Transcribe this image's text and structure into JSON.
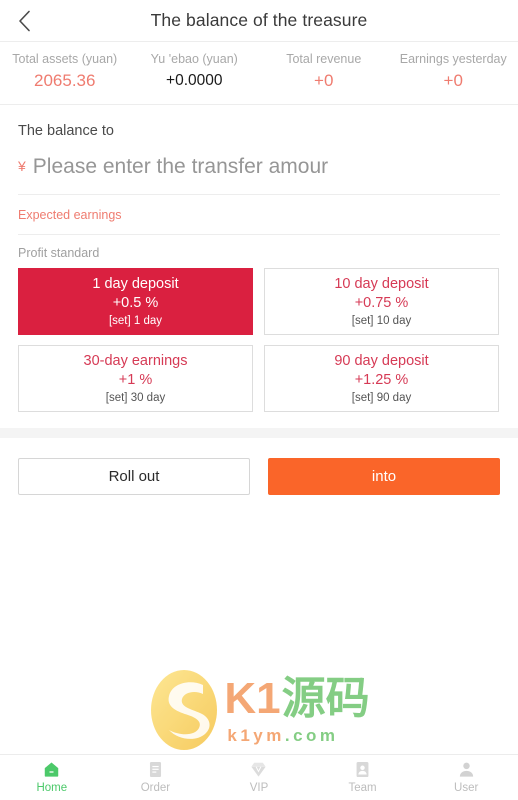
{
  "header": {
    "title": "The balance of the treasure",
    "back_icon": "chevron-left-icon"
  },
  "stats": [
    {
      "label": "Total assets (yuan)",
      "value": "2065.36",
      "tone": "red"
    },
    {
      "label": "Yu 'ebao (yuan)",
      "value": "+0.0000",
      "tone": "dark"
    },
    {
      "label": "Total revenue",
      "value": "+0",
      "tone": "red"
    },
    {
      "label": "Earnings yesterday",
      "value": "+0",
      "tone": "red"
    }
  ],
  "transfer": {
    "section_label": "The balance to",
    "currency_symbol": "¥",
    "amount_value": "",
    "amount_placeholder": "Please enter the transfer amour",
    "expected_earnings_label": "Expected earnings",
    "profit_standard_label": "Profit standard"
  },
  "plans": [
    {
      "title": "1 day deposit",
      "rate": "+0.5 %",
      "set": "[set] 1 day",
      "selected": true
    },
    {
      "title": "10 day deposit",
      "rate": "+0.75 %",
      "set": "[set] 10 day",
      "selected": false
    },
    {
      "title": "30-day earnings",
      "rate": "+1 %",
      "set": "[set] 30 day",
      "selected": false
    },
    {
      "title": "90 day deposit",
      "rate": "+1.25 %",
      "set": "[set] 90 day",
      "selected": false
    }
  ],
  "actions": {
    "roll_out_label": "Roll out",
    "into_label": "into"
  },
  "watermark": {
    "logo_icon": "k1-s-logo-icon",
    "brand_latin": "K1",
    "brand_cjk": "源码",
    "domain_part1": "k1ym",
    "domain_part2": ".com"
  },
  "tabbar": [
    {
      "label": "Home",
      "icon": "home-icon",
      "active": true
    },
    {
      "label": "Order",
      "icon": "order-icon",
      "active": false
    },
    {
      "label": "VIP",
      "icon": "vip-icon",
      "active": false
    },
    {
      "label": "Team",
      "icon": "team-icon",
      "active": false
    },
    {
      "label": "User",
      "icon": "user-icon",
      "active": false
    }
  ],
  "colors": {
    "accent_red": "#da2040",
    "soft_red": "#ef7c70",
    "orange": "#fa6529",
    "green": "#4cc96a",
    "muted": "#a8a8a8"
  }
}
